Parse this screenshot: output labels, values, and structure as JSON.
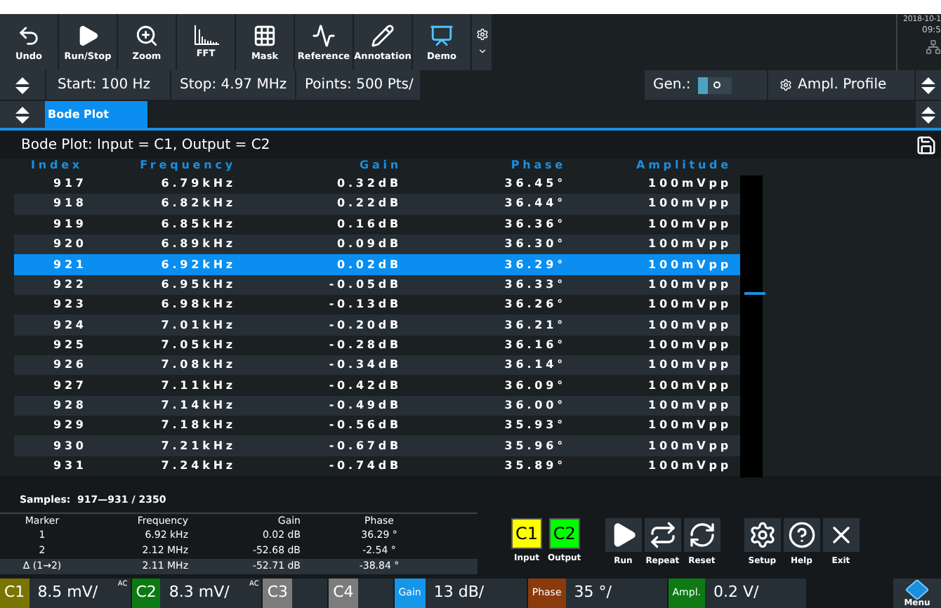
{
  "toolbar": [
    {
      "label": "Undo",
      "kind": "undo"
    },
    {
      "label": "Run/Stop",
      "kind": "run"
    },
    {
      "label": "Zoom",
      "kind": "zoom"
    },
    {
      "label": "FFT",
      "kind": "fft"
    },
    {
      "label": "Mask",
      "kind": "mask"
    },
    {
      "label": "Reference",
      "kind": "reference"
    },
    {
      "label": "Annotation",
      "kind": "annotation"
    },
    {
      "label": "Demo",
      "kind": "demo"
    }
  ],
  "clock": {
    "date": "2018-10-1",
    "time": "09:5"
  },
  "settings_bar": {
    "start": "Start: 100 Hz",
    "stop": "Stop: 4.97 MHz",
    "points": "Points: 500 Pts/",
    "generator_label": "Gen.:",
    "generator_on": false,
    "ampl_profile": "Ampl. Profile"
  },
  "tabs": [
    {
      "label": "Bode Plot",
      "selected": true
    }
  ],
  "title": "Bode Plot: Input = C1, Output = C2",
  "table": {
    "columns": [
      "Index",
      "Frequency",
      "Gain",
      "Phase",
      "Amplitude"
    ],
    "rows": [
      {
        "cells": [
          "917",
          "6.79kHz",
          "0.32dB",
          "36.45°",
          "100mVpp"
        ],
        "selected": false
      },
      {
        "cells": [
          "918",
          "6.82kHz",
          "0.22dB",
          "36.44°",
          "100mVpp"
        ],
        "selected": false
      },
      {
        "cells": [
          "919",
          "6.85kHz",
          "0.16dB",
          "36.36°",
          "100mVpp"
        ],
        "selected": false
      },
      {
        "cells": [
          "920",
          "6.89kHz",
          "0.09dB",
          "36.30°",
          "100mVpp"
        ],
        "selected": false
      },
      {
        "cells": [
          "921",
          "6.92kHz",
          "0.02dB",
          "36.29°",
          "100mVpp"
        ],
        "selected": true
      },
      {
        "cells": [
          "922",
          "6.95kHz",
          "-0.05dB",
          "36.33°",
          "100mVpp"
        ],
        "selected": false
      },
      {
        "cells": [
          "923",
          "6.98kHz",
          "-0.13dB",
          "36.26°",
          "100mVpp"
        ],
        "selected": false
      },
      {
        "cells": [
          "924",
          "7.01kHz",
          "-0.20dB",
          "36.21°",
          "100mVpp"
        ],
        "selected": false
      },
      {
        "cells": [
          "925",
          "7.05kHz",
          "-0.28dB",
          "36.16°",
          "100mVpp"
        ],
        "selected": false
      },
      {
        "cells": [
          "926",
          "7.08kHz",
          "-0.34dB",
          "36.14°",
          "100mVpp"
        ],
        "selected": false
      },
      {
        "cells": [
          "927",
          "7.11kHz",
          "-0.42dB",
          "36.09°",
          "100mVpp"
        ],
        "selected": false
      },
      {
        "cells": [
          "928",
          "7.14kHz",
          "-0.49dB",
          "36.00°",
          "100mVpp"
        ],
        "selected": false
      },
      {
        "cells": [
          "929",
          "7.18kHz",
          "-0.56dB",
          "35.93°",
          "100mVpp"
        ],
        "selected": false
      },
      {
        "cells": [
          "930",
          "7.21kHz",
          "-0.67dB",
          "35.96°",
          "100mVpp"
        ],
        "selected": false
      },
      {
        "cells": [
          "931",
          "7.24kHz",
          "-0.74dB",
          "35.89°",
          "100mVpp"
        ],
        "selected": false
      }
    ]
  },
  "samples": "Samples:  917—931 / 2350",
  "markers": {
    "columns": [
      "Marker",
      "Frequency",
      "Gain",
      "Phase"
    ],
    "rows": [
      {
        "cells": [
          "1",
          "6.92 kHz",
          "0.02 dB",
          "36.29 °"
        ],
        "selected": false
      },
      {
        "cells": [
          "2",
          "2.12 MHz",
          "-52.68 dB",
          "-2.54 °"
        ],
        "selected": false
      },
      {
        "cells": [
          "Δ (1→2)",
          "2.11 MHz",
          "-52.71 dB",
          "-38.84 °"
        ],
        "selected": true
      }
    ]
  },
  "channel_buttons": [
    {
      "label": "C1",
      "caption": "Input",
      "color": "#ffff00"
    },
    {
      "label": "C2",
      "caption": "Output",
      "color": "#00ff00"
    }
  ],
  "actions": [
    {
      "label": "Run",
      "kind": "run"
    },
    {
      "label": "Repeat",
      "kind": "repeat"
    },
    {
      "label": "Reset",
      "kind": "reset"
    }
  ],
  "help_actions": [
    {
      "label": "Setup",
      "kind": "setup"
    },
    {
      "label": "Help",
      "kind": "help"
    },
    {
      "label": "Exit",
      "kind": "exit"
    }
  ],
  "status": [
    {
      "label": "C1",
      "value": "8.5 mV/",
      "coupling": "AC",
      "color": "#7a7400"
    },
    {
      "label": "C2",
      "value": "8.3 mV/",
      "coupling": "AC",
      "color": "#0b7a12"
    },
    {
      "label": "C3",
      "color": "#7c7c7c"
    },
    {
      "label": "C4",
      "color": "#7c7c7c"
    },
    {
      "label": "Gain",
      "value": "13 dB/",
      "color": "#1596e8"
    },
    {
      "label": "Phase",
      "value": "35 °/",
      "color": "#8a3a0c"
    },
    {
      "label": "Ampl.",
      "value": "0.2 V/",
      "color": "#0d7a14"
    }
  ],
  "menu": "Menu"
}
